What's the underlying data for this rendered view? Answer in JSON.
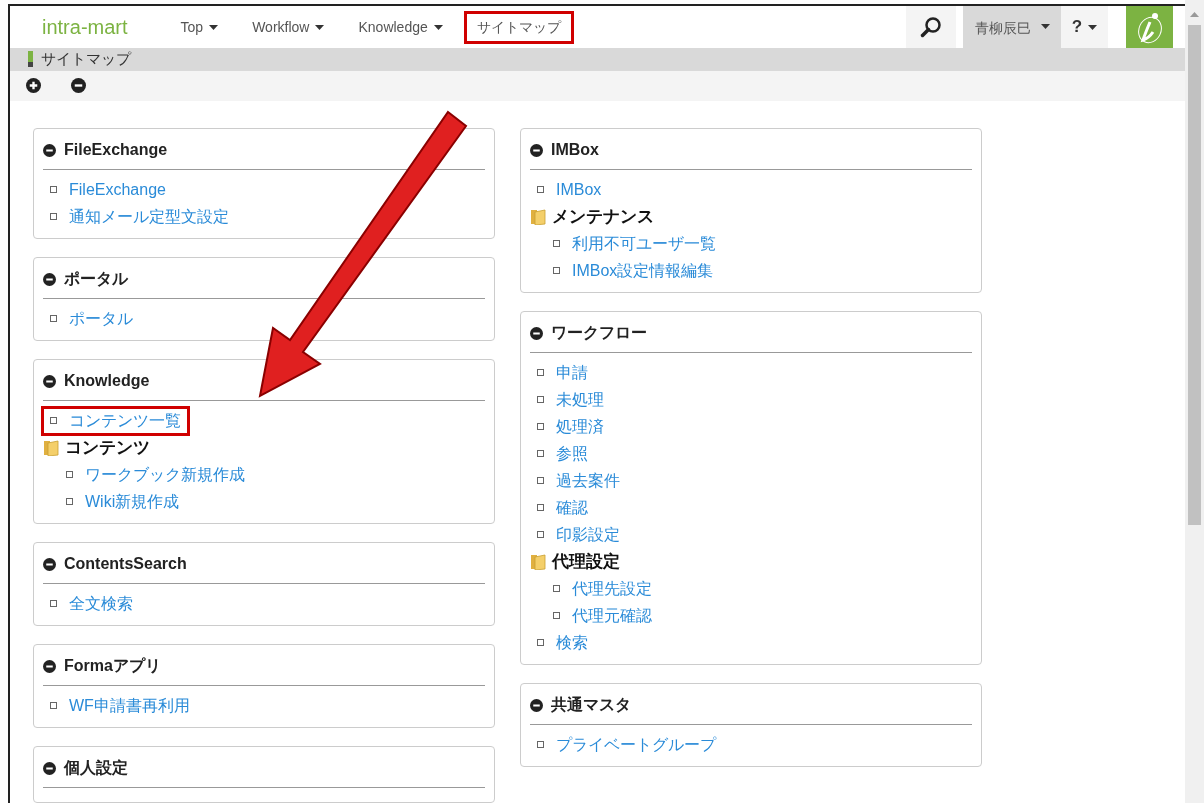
{
  "header": {
    "logo": "intra-mart",
    "nav": [
      {
        "label": "Top",
        "dropdown": true,
        "highlighted": false
      },
      {
        "label": "Workflow",
        "dropdown": true,
        "highlighted": false
      },
      {
        "label": "Knowledge",
        "dropdown": true,
        "highlighted": false
      },
      {
        "label": "サイトマップ",
        "dropdown": false,
        "highlighted": true
      }
    ],
    "user": "青柳辰巳",
    "help": "?"
  },
  "title_bar": {
    "title": "サイトマップ"
  },
  "columns": [
    [
      {
        "title": "FileExchange",
        "items": [
          {
            "kind": "link",
            "label": "FileExchange",
            "highlighted": false
          },
          {
            "kind": "link",
            "label": "通知メール定型文設定",
            "highlighted": false
          }
        ]
      },
      {
        "title": "ポータル",
        "items": [
          {
            "kind": "link",
            "label": "ポータル",
            "highlighted": false
          }
        ]
      },
      {
        "title": "Knowledge",
        "items": [
          {
            "kind": "link",
            "label": "コンテンツ一覧",
            "highlighted": true
          },
          {
            "kind": "folder",
            "label": "コンテンツ",
            "children": [
              {
                "kind": "link",
                "label": "ワークブック新規作成",
                "highlighted": false
              },
              {
                "kind": "link",
                "label": "Wiki新規作成",
                "highlighted": false
              }
            ]
          }
        ]
      },
      {
        "title": "ContentsSearch",
        "items": [
          {
            "kind": "link",
            "label": "全文検索",
            "highlighted": false
          }
        ]
      },
      {
        "title": "Formaアプリ",
        "items": [
          {
            "kind": "link",
            "label": "WF申請書再利用",
            "highlighted": false
          }
        ]
      },
      {
        "title": "個人設定"
      }
    ],
    [
      {
        "title": "IMBox",
        "items": [
          {
            "kind": "link",
            "label": "IMBox",
            "highlighted": false
          },
          {
            "kind": "folder",
            "label": "メンテナンス",
            "children": [
              {
                "kind": "link",
                "label": "利用不可ユーザ一覧",
                "highlighted": false
              },
              {
                "kind": "link",
                "label": "IMBox設定情報編集",
                "highlighted": false
              }
            ]
          }
        ]
      },
      {
        "title": "ワークフロー",
        "items": [
          {
            "kind": "link",
            "label": "申請",
            "highlighted": false
          },
          {
            "kind": "link",
            "label": "未処理",
            "highlighted": false
          },
          {
            "kind": "link",
            "label": "処理済",
            "highlighted": false
          },
          {
            "kind": "link",
            "label": "参照",
            "highlighted": false
          },
          {
            "kind": "link",
            "label": "過去案件",
            "highlighted": false
          },
          {
            "kind": "link",
            "label": "確認",
            "highlighted": false
          },
          {
            "kind": "link",
            "label": "印影設定",
            "highlighted": false
          },
          {
            "kind": "folder",
            "label": "代理設定",
            "children": [
              {
                "kind": "link",
                "label": "代理先設定",
                "highlighted": false
              },
              {
                "kind": "link",
                "label": "代理元確認",
                "highlighted": false
              }
            ]
          },
          {
            "kind": "link",
            "label": "検索",
            "highlighted": false
          }
        ]
      },
      {
        "title": "共通マスタ",
        "items": [
          {
            "kind": "link",
            "label": "プライベートグループ",
            "highlighted": false
          }
        ]
      }
    ]
  ]
}
